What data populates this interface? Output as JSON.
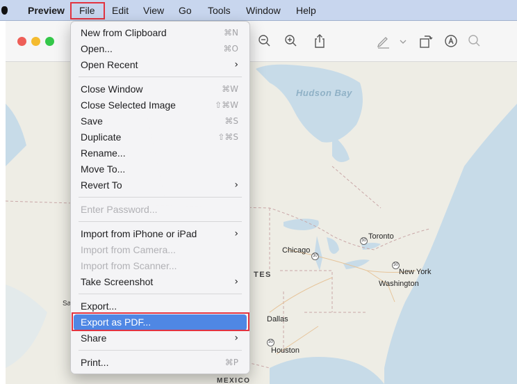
{
  "menubar": {
    "app_name": "Preview",
    "items": [
      "File",
      "Edit",
      "View",
      "Go",
      "Tools",
      "Window",
      "Help"
    ]
  },
  "map": {
    "labels": {
      "hudson_bay": "Hudson Bay",
      "toronto": "Toronto",
      "chicago": "Chicago",
      "new_york": "New York",
      "washington": "Washington",
      "dallas": "Dallas",
      "houston": "Houston",
      "mexico": "MEXICO",
      "states_fragment": "TES",
      "sar_fragment": "Sar"
    },
    "highway_shield": "30"
  },
  "file_menu": {
    "new_from_clipboard": {
      "label": "New from Clipboard",
      "shortcut": "⌘N"
    },
    "open": {
      "label": "Open...",
      "shortcut": "⌘O"
    },
    "open_recent": {
      "label": "Open Recent"
    },
    "close_window": {
      "label": "Close Window",
      "shortcut": "⌘W"
    },
    "close_selected_image": {
      "label": "Close Selected Image",
      "shortcut": "⇧⌘W"
    },
    "save": {
      "label": "Save",
      "shortcut": "⌘S"
    },
    "duplicate": {
      "label": "Duplicate",
      "shortcut": "⇧⌘S"
    },
    "rename": {
      "label": "Rename..."
    },
    "move_to": {
      "label": "Move To..."
    },
    "revert_to": {
      "label": "Revert To"
    },
    "enter_password": {
      "label": "Enter Password..."
    },
    "import_from_iphone": {
      "label": "Import from iPhone or iPad"
    },
    "import_from_camera": {
      "label": "Import from Camera..."
    },
    "import_from_scanner": {
      "label": "Import from Scanner..."
    },
    "take_screenshot": {
      "label": "Take Screenshot"
    },
    "export": {
      "label": "Export..."
    },
    "export_as_pdf": {
      "label": "Export as PDF..."
    },
    "share": {
      "label": "Share"
    },
    "print": {
      "label": "Print...",
      "shortcut": "⌘P"
    }
  },
  "colors": {
    "highlight": "#4f87e4",
    "annotation_red": "#e23340",
    "menubar_bg": "#c8d6ee"
  }
}
